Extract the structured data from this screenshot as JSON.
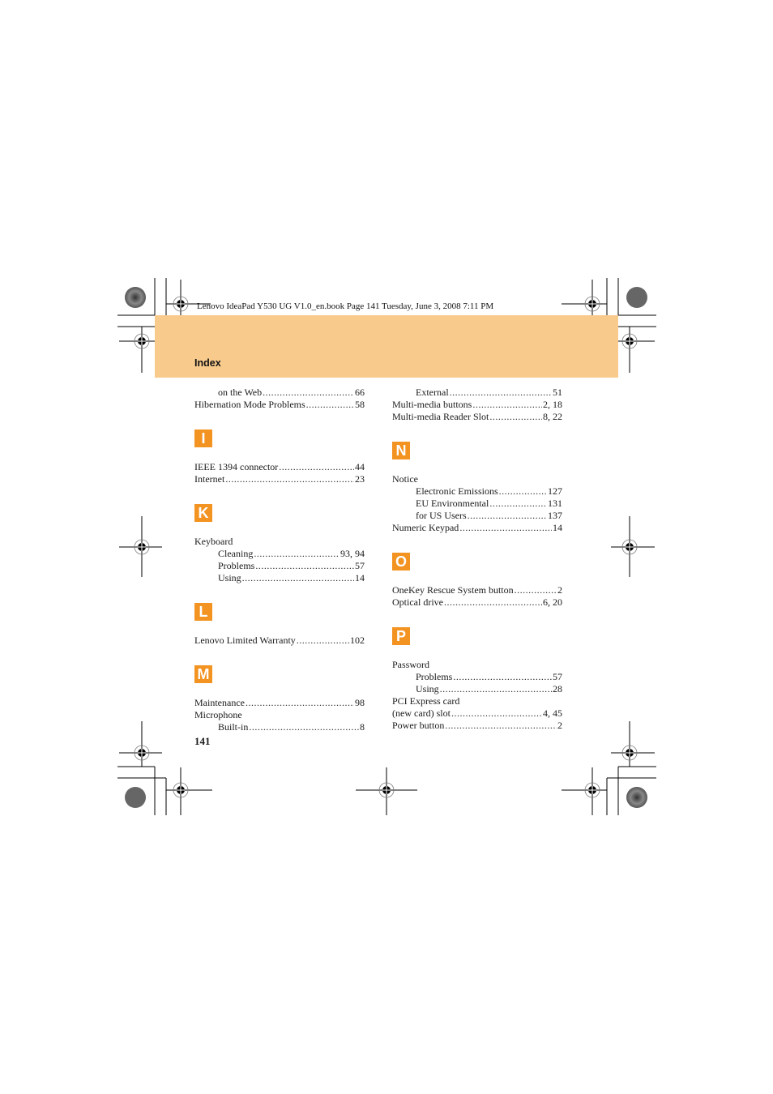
{
  "header": {
    "book_info": "Lenovo IdeaPad Y530 UG V1.0_en.book  Page 141  Tuesday, June 3, 2008  7:11 PM",
    "section_title": "Index",
    "band_color": "#f8cb8d",
    "letter_color": "#f39321"
  },
  "left_column": {
    "pre_entries": [
      {
        "label": "on the Web",
        "page": "66",
        "sub": true
      },
      {
        "label": "Hibernation Mode Problems",
        "page": "58",
        "sub": false
      }
    ],
    "sections": [
      {
        "letter": "I",
        "entries": [
          {
            "label": "IEEE 1394 connector",
            "page": "44",
            "sub": false
          },
          {
            "label": "Internet",
            "page": "23",
            "sub": false
          }
        ]
      },
      {
        "letter": "K",
        "entries": [
          {
            "label": "Keyboard",
            "page": "",
            "sub": false
          },
          {
            "label": "Cleaning",
            "page": "93, 94",
            "sub": true
          },
          {
            "label": "Problems",
            "page": "57",
            "sub": true
          },
          {
            "label": "Using",
            "page": "14",
            "sub": true
          }
        ]
      },
      {
        "letter": "L",
        "entries": [
          {
            "label": "Lenovo Limited Warranty",
            "page": "102",
            "sub": false
          }
        ]
      },
      {
        "letter": "M",
        "entries": [
          {
            "label": "Maintenance",
            "page": "98",
            "sub": false
          },
          {
            "label": "Microphone",
            "page": "",
            "sub": false
          },
          {
            "label": "Built-in",
            "page": "8",
            "sub": true
          }
        ]
      }
    ]
  },
  "right_column": {
    "pre_entries": [
      {
        "label": "External",
        "page": "51",
        "sub": true
      },
      {
        "label": "Multi-media buttons",
        "page": "2, 18",
        "sub": false
      },
      {
        "label": "Multi-media Reader Slot",
        "page": "8, 22",
        "sub": false
      }
    ],
    "sections": [
      {
        "letter": "N",
        "entries": [
          {
            "label": "Notice",
            "page": "",
            "sub": false
          },
          {
            "label": "Electronic Emissions",
            "page": "127",
            "sub": true
          },
          {
            "label": "EU Environmental",
            "page": "131",
            "sub": true
          },
          {
            "label": "for US Users",
            "page": "137",
            "sub": true
          },
          {
            "label": "Numeric Keypad",
            "page": "14",
            "sub": false
          }
        ]
      },
      {
        "letter": "O",
        "entries": [
          {
            "label": "OneKey Rescue System button",
            "page": "2",
            "sub": false
          },
          {
            "label": "Optical drive",
            "page": "6, 20",
            "sub": false
          }
        ]
      },
      {
        "letter": "P",
        "entries": [
          {
            "label": "Password",
            "page": "",
            "sub": false
          },
          {
            "label": "Problems",
            "page": "57",
            "sub": true
          },
          {
            "label": "Using",
            "page": "28",
            "sub": true
          },
          {
            "label": "PCI Express card",
            "page": "",
            "sub": false
          },
          {
            "label": "(new card) slot",
            "page": "4, 45",
            "sub": false
          },
          {
            "label": "Power button",
            "page": "2",
            "sub": false
          }
        ]
      }
    ]
  },
  "footer": {
    "page_number": "141"
  }
}
